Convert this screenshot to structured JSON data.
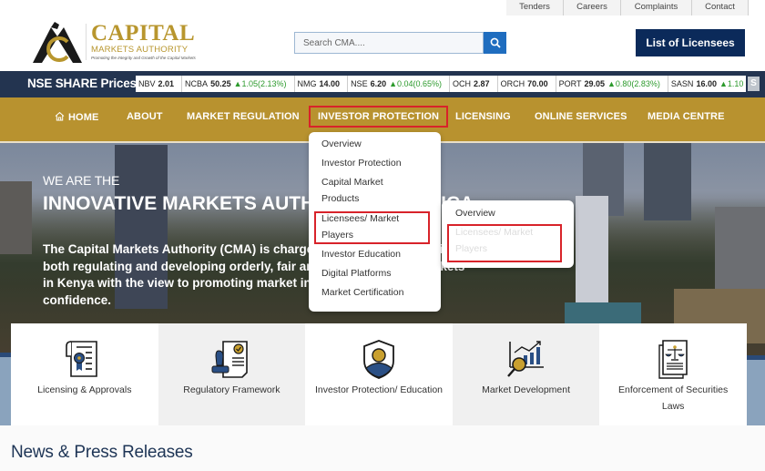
{
  "utility_nav": [
    "Tenders",
    "Careers",
    "Complaints",
    "Contact"
  ],
  "logo": {
    "title": "CAPITAL",
    "subtitle": "MARKETS AUTHORITY",
    "tagline": "Promoting the Integrity and Growth of the Capital Markets"
  },
  "search": {
    "placeholder": "Search CMA....",
    "icon": "search-icon"
  },
  "header_button": "List of Licensees",
  "ticker": {
    "label": "NSE SHARE Prices",
    "items": [
      {
        "symbol": "NBV",
        "price": "2.01",
        "change": ""
      },
      {
        "symbol": "NCBA",
        "price": "50.25",
        "change": "▲1.05(2.13%)"
      },
      {
        "symbol": "NMG",
        "price": "14.00",
        "change": ""
      },
      {
        "symbol": "NSE",
        "price": "6.20",
        "change": "▲0.04(0.65%)"
      },
      {
        "symbol": "OCH",
        "price": "2.87",
        "change": ""
      },
      {
        "symbol": "ORCH",
        "price": "70.00",
        "change": ""
      },
      {
        "symbol": "PORT",
        "price": "29.05",
        "change": "▲0.80(2.83%)"
      },
      {
        "symbol": "SASN",
        "price": "16.00",
        "change": "▲1.10"
      }
    ],
    "toggle": "S",
    "up_color": "#2c9a2c"
  },
  "nav": {
    "items": [
      "HOME",
      "ABOUT",
      "MARKET REGULATION",
      "INVESTOR PROTECTION",
      "LICENSING",
      "ONLINE SERVICES",
      "MEDIA CENTRE"
    ],
    "active": "INVESTOR PROTECTION"
  },
  "dropdown": {
    "items": [
      "Overview",
      "Investor Protection",
      "Capital Market",
      "Products",
      "Licensees/ Market",
      "Players",
      "Investor Education",
      "Digital Platforms",
      "Market Certification"
    ],
    "submenu": [
      "Overview",
      "Licensees/ Market",
      "Players"
    ]
  },
  "hero": {
    "subtitle": "WE ARE THE",
    "title": "INNOVATIVE MARKETS AUTHORITY IN AFRICA",
    "text": "The Capital Markets Authority (CMA) is charged with the responsibility of both regulating and developing orderly, fair and efficient capital markets in Kenya with the view to promoting market integrity and investor confidence."
  },
  "features": [
    {
      "label": "Licensing & Approvals",
      "icon": "certificate-icon"
    },
    {
      "label": "Regulatory Framework",
      "icon": "stamp-document-icon"
    },
    {
      "label": "Investor Protection/ Education",
      "icon": "shield-person-icon"
    },
    {
      "label": "Market Development",
      "icon": "chart-magnifier-icon"
    },
    {
      "label": "Enforcement of Securities Laws",
      "icon": "scales-document-icon"
    }
  ],
  "news_heading": "News & Press Releases",
  "colors": {
    "gold": "#b8922f",
    "navy": "#0b2a5a",
    "ticker_bg": "#233450",
    "highlight": "#d8232a"
  }
}
